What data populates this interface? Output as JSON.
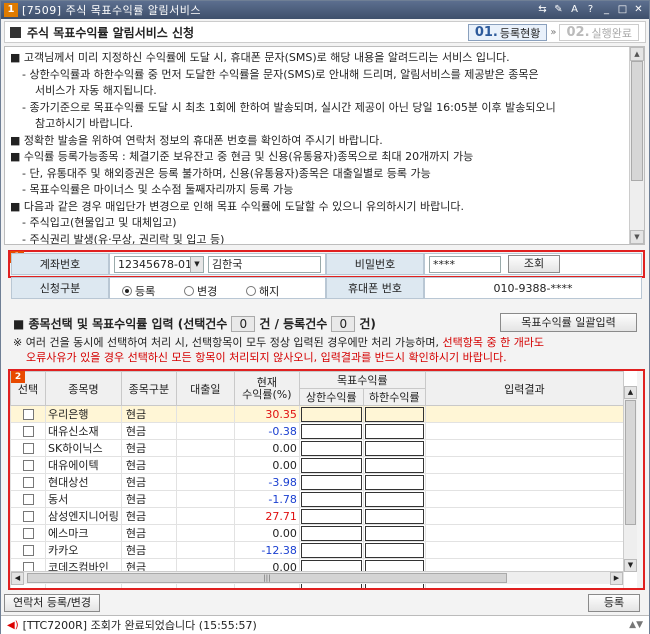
{
  "window": {
    "screen_no": "1",
    "title": "[7509] 주식 목표수익률 알림서비스",
    "tb_icons": [
      "⇆",
      "✎",
      "A",
      "?",
      "_",
      "□",
      "✕"
    ]
  },
  "header": {
    "title": "주식 목표수익률 알림서비스 신청",
    "steps": [
      {
        "num": "01.",
        "label": "등록현황"
      },
      {
        "num": "02.",
        "label": "실행완료"
      }
    ],
    "step_arrow": "»"
  },
  "notice": [
    {
      "cls": "",
      "text": "■ 고객님께서 미리 지정하신 수익률에 도달 시, 휴대폰 문자(SMS)로 해당 내용을 알려드리는 서비스 입니다."
    },
    {
      "cls": "ind",
      "text": "- 상한수익률과 하한수익률 중 먼저 도달한 수익률을 문자(SMS)로 안내해 드리며, 알림서비스를 제공받은 종목은"
    },
    {
      "cls": "ind2",
      "text": "서비스가 자동 해지됩니다."
    },
    {
      "cls": "ind",
      "text": "- 종가기준으로 목표수익률 도달 시 최초 1회에 한하여 발송되며, 실시간 제공이 아닌 당일 16:05분 이후 발송되오니"
    },
    {
      "cls": "ind2",
      "text": "참고하시기 바랍니다."
    },
    {
      "cls": "",
      "text": "■ 정확한 발송을 위하여 연락처 정보의 휴대폰 번호를 확인하여 주시기 바랍니다."
    },
    {
      "cls": "",
      "text": "■ 수익률 등록가능종목 : 체결기준 보유잔고 중 현금 및 신용(유통융자)종목으로 최대 20개까지 가능"
    },
    {
      "cls": "ind",
      "text": "- 단, 유통대주 및 해외증권은 등록 불가하며, 신용(유통융자)종목은 대출일별로 등록 가능"
    },
    {
      "cls": "ind",
      "text": "- 목표수익률은 마이너스 및 소수점 둘째자리까지 등록 가능"
    },
    {
      "cls": "",
      "text": "■ 다음과 같은 경우 매입단가 변경으로 인해 목표 수익률에 도달할 수 있으니 유의하시기 바랍니다."
    },
    {
      "cls": "ind",
      "text": "- 주식입고(현물입고 및 대체입고)"
    },
    {
      "cls": "ind",
      "text": "- 주식권리 발생(유·무상, 권리락 및 입고 등)"
    }
  ],
  "account": {
    "badge": "1",
    "acct_label": "계좌번호",
    "acct_value": "12345678-01",
    "owner_name": "김한국",
    "pw_label": "비밀번호",
    "pw_value": "****",
    "query_btn": "조회",
    "type_label": "신청구분",
    "radios": [
      "등록",
      "변경",
      "해지"
    ],
    "phone_label": "휴대폰 번호",
    "phone_value": "010-9388-****"
  },
  "section": {
    "title_pre": "■ 종목선택 및 목표수익률 입력 (선택건수",
    "sel_count": "0",
    "title_mid": "건 / 등록건수",
    "reg_count": "0",
    "title_end": "건)",
    "bulk_btn": "목표수익률 일괄입력",
    "warn_black": "※ 여러 건을 동시에 선택하여 처리 시, 선택항목이 모두 정상 입력된 경우에만 처리 가능하며,",
    "warn_red1": " 선택항목 중 한 개라도",
    "warn_red2": "오류사유가 있을 경우 선택하신 모든 항목이 처리되지 않사오니, 입력결과를 반드시 확인하시기 바랍니다."
  },
  "grid": {
    "badge": "2",
    "headers": {
      "select": "선택",
      "name": "종목명",
      "type": "종목구분",
      "loan_date": "대출일",
      "cur_rate_1": "현재",
      "cur_rate_2": "수익률(%)",
      "target": "목표수익률",
      "upper": "상한수익률",
      "lower": "하한수익률",
      "result": "입력결과"
    },
    "rows": [
      {
        "name": "우리은행",
        "type": "현금",
        "rate": "30.35"
      },
      {
        "name": "대유신소재",
        "type": "현금",
        "rate": "-0.38"
      },
      {
        "name": "SK하이닉스",
        "type": "현금",
        "rate": "0.00"
      },
      {
        "name": "대유에이텍",
        "type": "현금",
        "rate": "0.00"
      },
      {
        "name": "현대상선",
        "type": "현금",
        "rate": "-3.98"
      },
      {
        "name": "동서",
        "type": "현금",
        "rate": "-1.78"
      },
      {
        "name": "삼성엔지니어링",
        "type": "현금",
        "rate": "27.71"
      },
      {
        "name": "에스마크",
        "type": "현금",
        "rate": "0.00"
      },
      {
        "name": "카카오",
        "type": "현금",
        "rate": "-12.38"
      },
      {
        "name": "코데즈컴바인",
        "type": "현금",
        "rate": "0.00"
      }
    ]
  },
  "footer": {
    "contact_btn": "연락처 등록/변경",
    "register_btn": "등록"
  },
  "status": {
    "message": "[TTC7200R] 조회가 완료되었습니다 (15:55:57)"
  },
  "colors": {
    "titlebar": "#4a5d7d",
    "label_bg": "#dde8f1",
    "positive": "#e01010",
    "negative": "#1a3fd0",
    "highlight_box": "#e02020",
    "selected_row": "#fff6d6"
  }
}
